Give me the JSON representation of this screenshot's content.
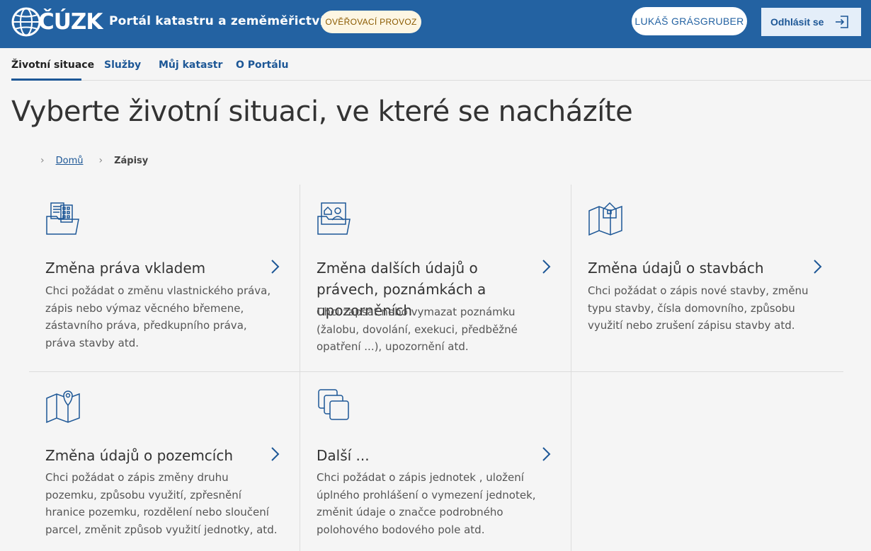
{
  "header": {
    "logo_text": "ČÚZK",
    "portal_title": "Portál katastru a zeměměřictví",
    "env_badge": "OVĚŘOVACÍ PROVOZ",
    "user_name": "LUKÁŠ GRÁSGRUBER",
    "logout_label": "Odhlásit se"
  },
  "nav": {
    "items": [
      {
        "label": "Životní situace",
        "active": true
      },
      {
        "label": "Služby",
        "active": false
      },
      {
        "label": "Můj katastr",
        "active": false
      },
      {
        "label": "O Portálu",
        "active": false
      }
    ]
  },
  "page": {
    "title": "Vyberte životní situaci, ve které se nacházíte"
  },
  "breadcrumb": {
    "home": "Domů",
    "current": "Zápisy"
  },
  "cards": [
    {
      "icon": "building-folder-icon",
      "title": "Změna práva vkladem",
      "description": "Chci požádat o změnu vlastnického práva, zápis nebo výmaz věcného břemene, zástavního práva, předkupního práva, práva stavby atd."
    },
    {
      "icon": "person-house-folder-icon",
      "title": "Změna dalších údajů o právech, poznámkách a upozorněních",
      "description": "Chci zapsat nebo vymazat poznámku (žalobu, dovolání, exekuci, předběžné opatření ...), upozornění atd."
    },
    {
      "icon": "house-map-icon",
      "title": "Změna údajů o stavbách",
      "description": "Chci požádat o zápis nové stavby, změnu typu stavby, čísla domovního, způsobu využití nebo zrušení zápisu stavby atd."
    },
    {
      "icon": "map-pin-icon",
      "title": "Změna údajů o pozemcích",
      "description": "Chci požádat o zápis změny druhu pozemku, způsobu využití, zpřesnění hranice pozemku, rozdělení nebo sloučení parcel, změnit způsob využití jednotky, atd."
    },
    {
      "icon": "stacked-squares-icon",
      "title": "Další ...",
      "description": "Chci požádat o zápis jednotek , uložení úplného prohlášení o vymezení jednotek, změnit údaje o značce podrobného polohového bodového pole atd."
    }
  ],
  "colors": {
    "header_bg": "#2362a2",
    "accent": "#1d5796",
    "badge_bg": "#fdf6e3",
    "badge_text": "#8a5a00",
    "logout_bg": "#e4eef9"
  }
}
